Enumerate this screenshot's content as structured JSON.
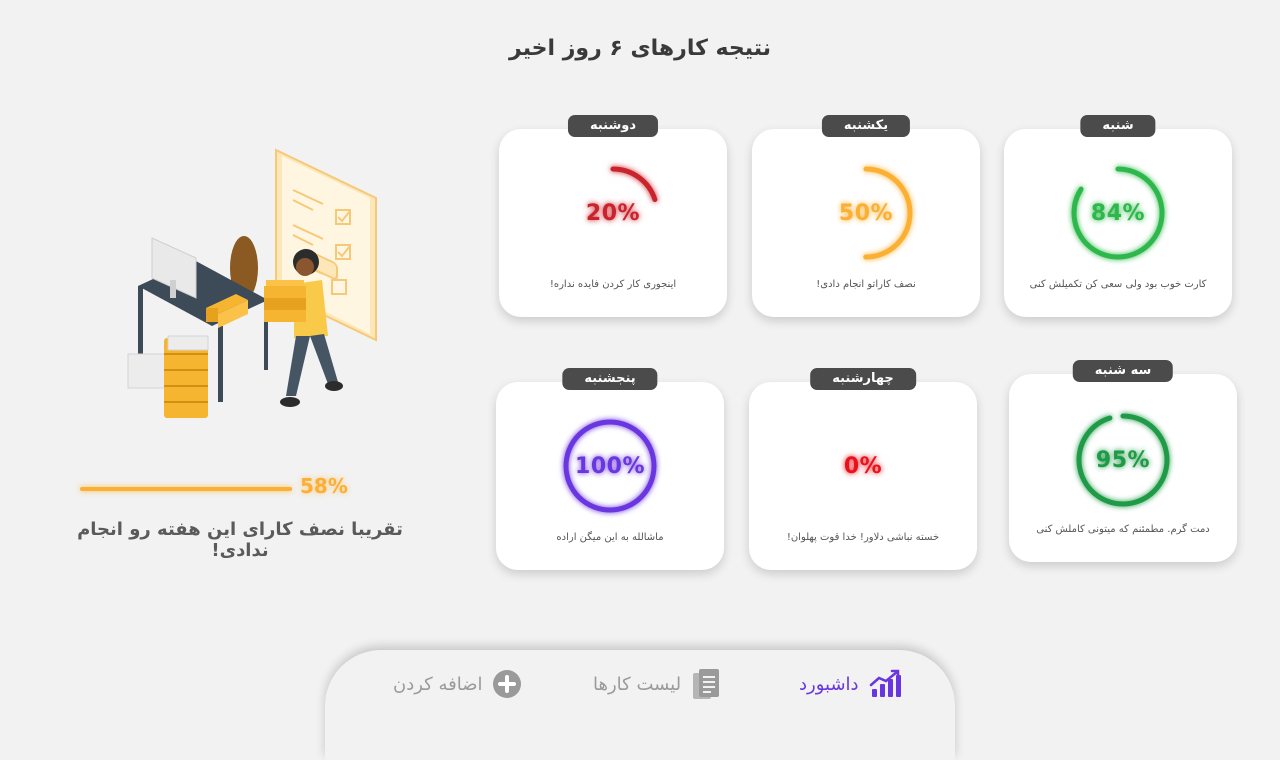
{
  "page": {
    "title": "نتیجه کارهای ۶ روز اخیر"
  },
  "days": [
    {
      "id": "sat",
      "name": "شنبه",
      "percent": 84,
      "percent_label": "84%",
      "message": "کارت خوب بود ولی سعی کن تکمیلش کنی",
      "color": "#2eb84b"
    },
    {
      "id": "sun",
      "name": "یکشنبه",
      "percent": 50,
      "percent_label": "50%",
      "message": "نصف کاراتو انجام دادی!",
      "color": "#fbb034"
    },
    {
      "id": "mon",
      "name": "دوشنبه",
      "percent": 20,
      "percent_label": "20%",
      "message": "اینجوری کار کردن فایده نداره!",
      "color": "#c9232c"
    },
    {
      "id": "tue",
      "name": "سه شنبه",
      "percent": 95,
      "percent_label": "95%",
      "message": "دمت گرم. مطمئنم که میتونی کاملش کنی",
      "color": "#1f9a46"
    },
    {
      "id": "wed",
      "name": "چهارشنبه",
      "percent": 0,
      "percent_label": "0%",
      "message": "خسته نباشی دلاور! خدا قوت پهلوان!",
      "color": "#e8121b"
    },
    {
      "id": "thu",
      "name": "پنجشنبه",
      "percent": 100,
      "percent_label": "100%",
      "message": "ماشالله به این میگن اراده",
      "color": "#6a36e0"
    }
  ],
  "weekly": {
    "percent": 58,
    "percent_label": "58%",
    "message": "تقریبا نصف کارای این هفته رو انجام ندادی!",
    "color": "#fbb034"
  },
  "nav": {
    "dashboard": {
      "label": "داشبورد",
      "icon": "chart-trend-icon",
      "color": "#6a36e0",
      "active": true
    },
    "task_list": {
      "label": "لیست کارها",
      "icon": "document-list-icon",
      "color": "#9a9a9a"
    },
    "add": {
      "label": "اضافه کردن",
      "icon": "plus-circle-icon",
      "color": "#9a9a9a"
    }
  }
}
